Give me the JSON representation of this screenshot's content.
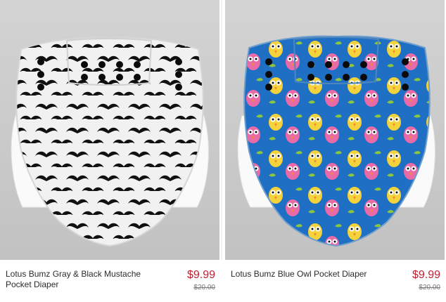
{
  "products": [
    {
      "title": "Lotus Bumz Gray & Black Mustache Pocket Diaper",
      "price": "$9.99",
      "original_price": "$20.00",
      "image": "mustache-diaper-image",
      "colors": {
        "base": "#f1f1f1",
        "pattern": "#111111",
        "snap": "#0b0b0b"
      }
    },
    {
      "title": "Lotus Bumz Blue Owl Pocket Diaper",
      "price": "$9.99",
      "original_price": "$20.00",
      "image": "owl-diaper-image",
      "colors": {
        "base": "#1f6fc4",
        "pattern": "#ffffff",
        "snap": "#0a0a0a",
        "accent1": "#f3d23b",
        "accent2": "#e96aa6",
        "accent3": "#8cc63f"
      }
    }
  ],
  "colors": {
    "price": "#c21f32",
    "background": "#ffffff"
  }
}
